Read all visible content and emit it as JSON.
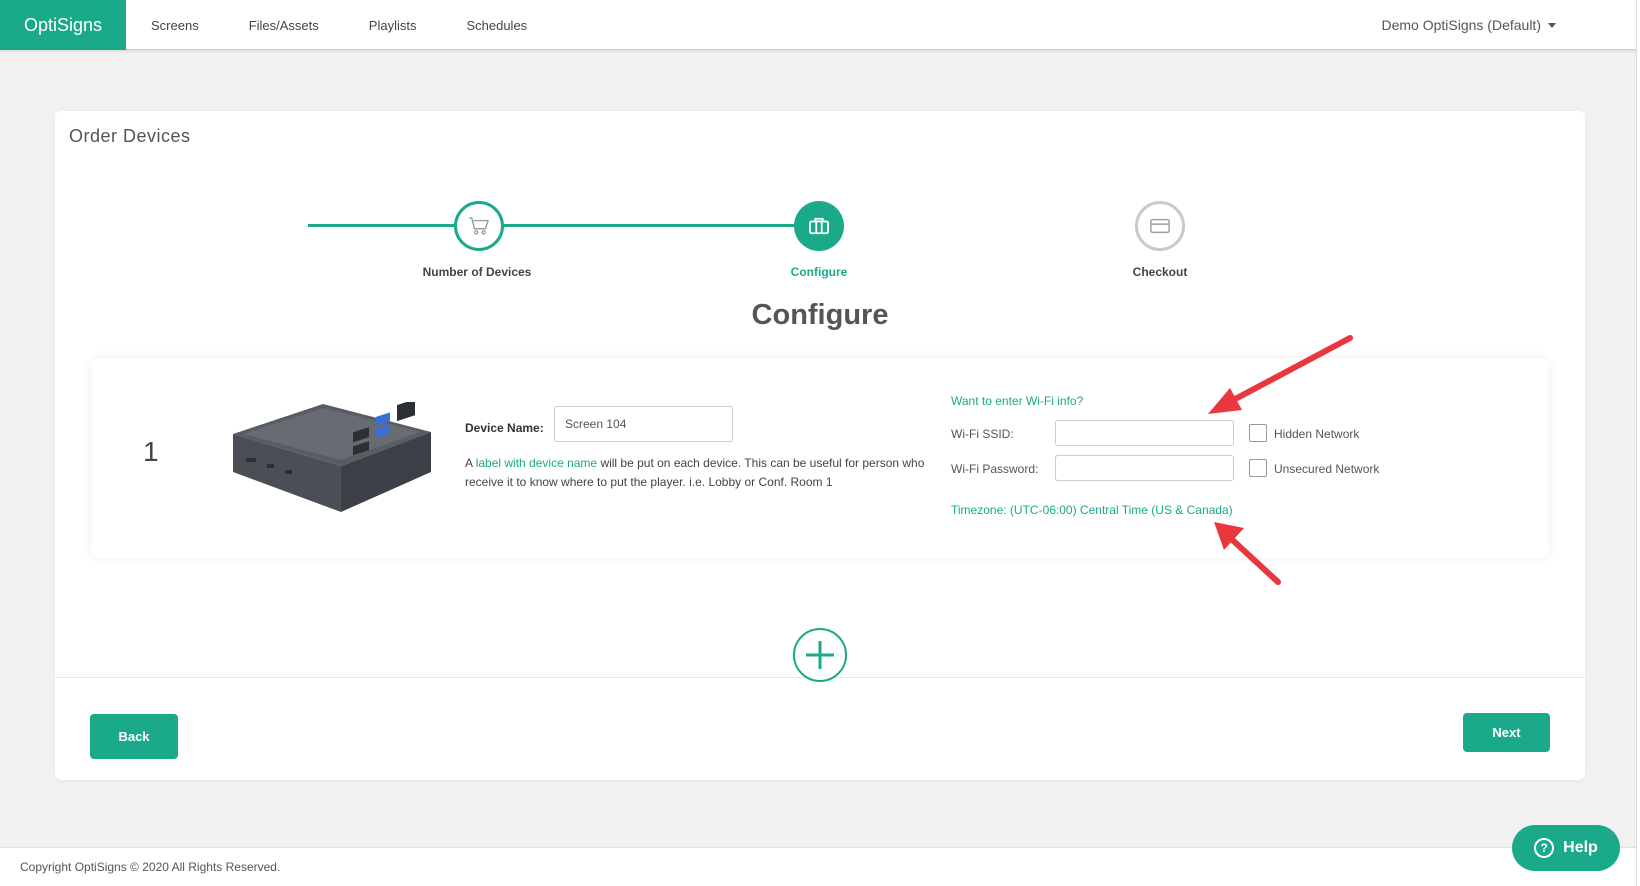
{
  "nav": {
    "brand": "OptiSigns",
    "links": [
      "Screens",
      "Files/Assets",
      "Playlists",
      "Schedules"
    ],
    "account": "Demo OptiSigns (Default)"
  },
  "page": {
    "title": "Order Devices",
    "section_title": "Configure"
  },
  "stepper": {
    "steps": [
      {
        "label": "Number of Devices",
        "icon": "cart-icon",
        "state": "done"
      },
      {
        "label": "Configure",
        "icon": "briefcase-icon",
        "state": "active"
      },
      {
        "label": "Checkout",
        "icon": "credit-card-icon",
        "state": "pending"
      }
    ]
  },
  "device": {
    "number": "1",
    "name_label": "Device Name:",
    "name_value": "Screen 104",
    "help_prefix": "A",
    "help_link": "label with device name",
    "help_suffix": "will be put on each device. This can be useful for person who receive it to know where to put the player. i.e. Lobby or Conf. Room 1"
  },
  "wifi": {
    "toggle_link": "Want to enter Wi-Fi info?",
    "ssid_label": "Wi-Fi SSID:",
    "ssid_value": "",
    "password_label": "Wi-Fi Password:",
    "password_value": "",
    "hidden_label": "Hidden Network",
    "unsecured_label": "Unsecured Network",
    "timezone": "Timezone: (UTC-06:00) Central Time (US & Canada)"
  },
  "actions": {
    "back": "Back",
    "next": "Next"
  },
  "footer": {
    "copyright": "Copyright OptiSigns © 2020 All Rights Reserved.",
    "help": "Help"
  },
  "colors": {
    "accent": "#1aa989",
    "annotation_arrow": "#e8383d"
  }
}
